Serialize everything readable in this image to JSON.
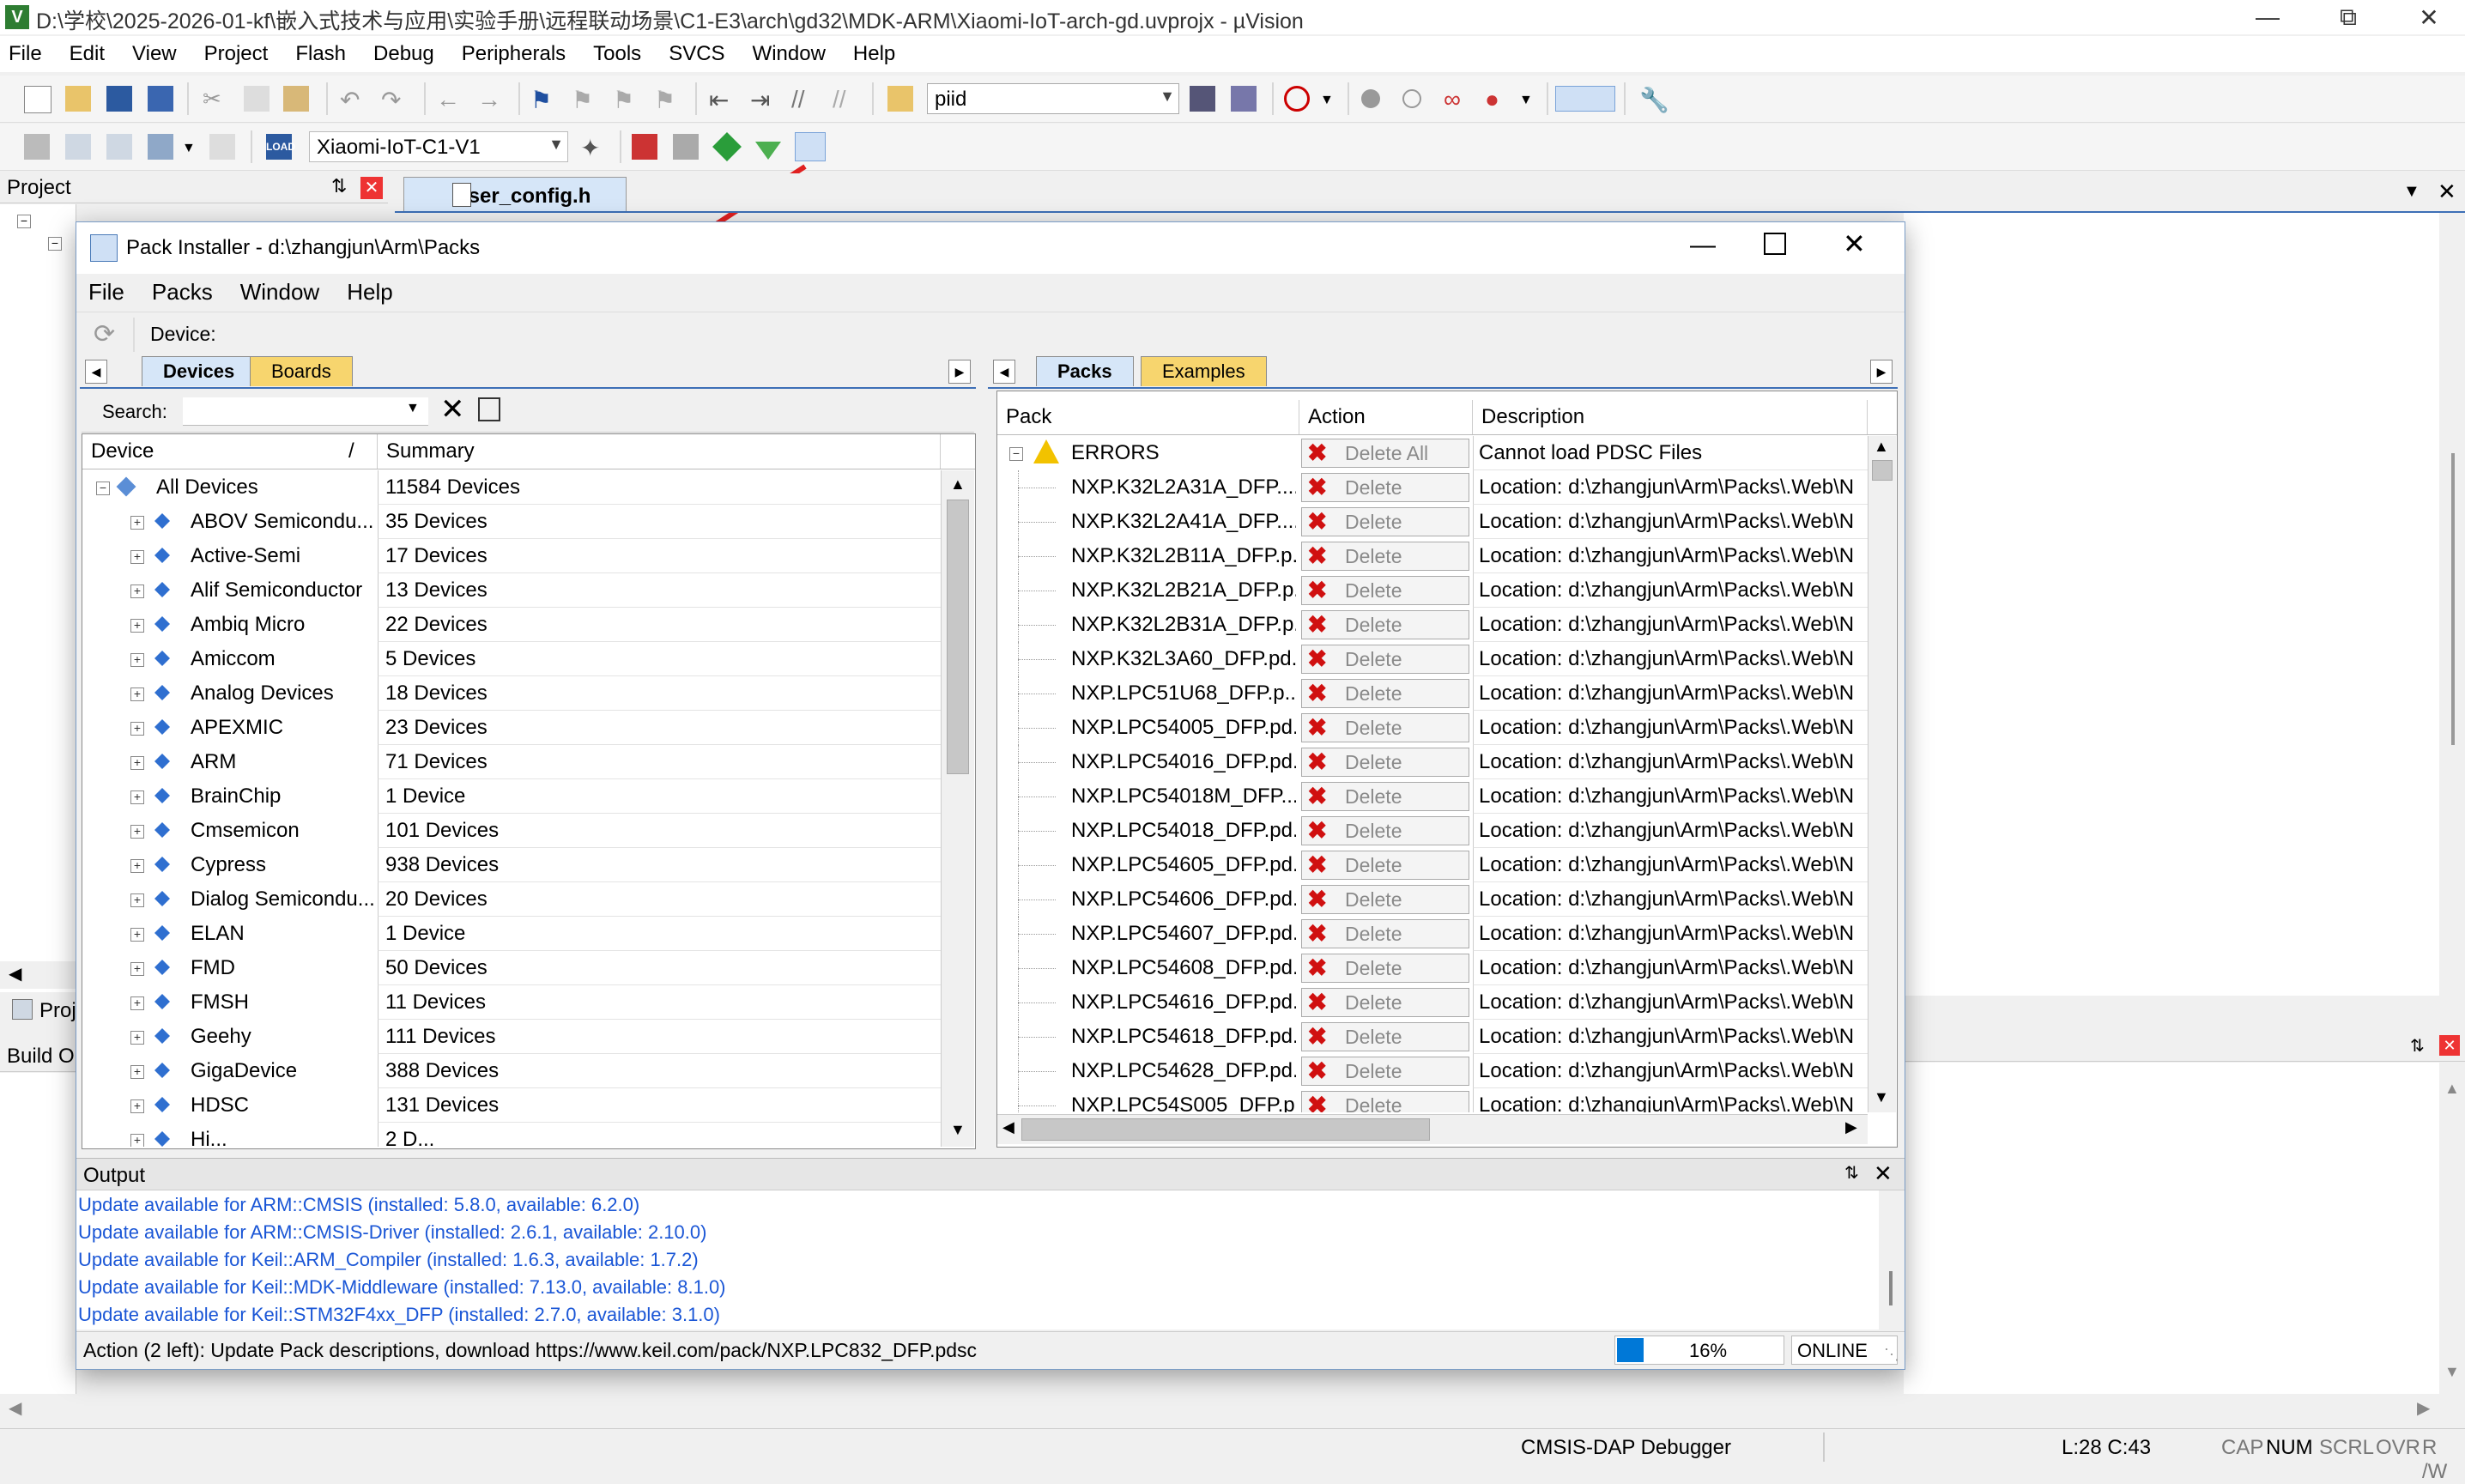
{
  "app": {
    "title": "D:\\学校\\2025-2026-01-kf\\嵌入式技术与应用\\实验手册\\远程联动场景\\C1-E3\\arch\\gd32\\MDK-ARM\\Xiaomi-IoT-arch-gd.uvprojx - µVision",
    "menu": [
      "File",
      "Edit",
      "View",
      "Project",
      "Flash",
      "Debug",
      "Peripherals",
      "Tools",
      "SVCS",
      "Window",
      "Help"
    ],
    "find_combo": "piid",
    "target_combo": "Xiaomi-IoT-C1-V1",
    "project_panel_title": "Project",
    "project_tab": "Proj",
    "build_output_title": "Build O",
    "editor_tab": "user_config.h",
    "status": {
      "debugger": "CMSIS-DAP Debugger",
      "position": "L:28 C:43",
      "cap": "CAP",
      "num": "NUM",
      "scrl": "SCRL",
      "ovr": "OVR",
      "rw": "R /W"
    }
  },
  "pack_installer": {
    "title": "Pack Installer - d:\\zhangjun\\Arm\\Packs",
    "menu": [
      "File",
      "Packs",
      "Window",
      "Help"
    ],
    "device_label": "Device:",
    "left_tabs": [
      "Devices",
      "Boards"
    ],
    "search_label": "Search:",
    "device_columns": [
      "Device",
      "Summary"
    ],
    "all_devices": {
      "name": "All Devices",
      "summary": "11584 Devices"
    },
    "vendors": [
      {
        "name": "ABOV Semicondu...",
        "summary": "35 Devices"
      },
      {
        "name": "Active-Semi",
        "summary": "17 Devices"
      },
      {
        "name": "Alif Semiconductor",
        "summary": "13 Devices"
      },
      {
        "name": "Ambiq Micro",
        "summary": "22 Devices"
      },
      {
        "name": "Amiccom",
        "summary": "5 Devices"
      },
      {
        "name": "Analog Devices",
        "summary": "18 Devices"
      },
      {
        "name": "APEXMIC",
        "summary": "23 Devices"
      },
      {
        "name": "ARM",
        "summary": "71 Devices"
      },
      {
        "name": "BrainChip",
        "summary": "1 Device"
      },
      {
        "name": "Cmsemicon",
        "summary": "101 Devices"
      },
      {
        "name": "Cypress",
        "summary": "938 Devices"
      },
      {
        "name": "Dialog Semicondu...",
        "summary": "20 Devices"
      },
      {
        "name": "ELAN",
        "summary": "1 Device"
      },
      {
        "name": "FMD",
        "summary": "50 Devices"
      },
      {
        "name": "FMSH",
        "summary": "11 Devices"
      },
      {
        "name": "Geehy",
        "summary": "111 Devices"
      },
      {
        "name": "GigaDevice",
        "summary": "388 Devices"
      },
      {
        "name": "HDSC",
        "summary": "131 Devices"
      },
      {
        "name": "Hi...",
        "summary": "2 D..."
      }
    ],
    "right_tabs": [
      "Packs",
      "Examples"
    ],
    "pack_columns": [
      "Pack",
      "Action",
      "Description"
    ],
    "errors_row": {
      "name": "ERRORS",
      "action": "Delete All",
      "description": "Cannot load PDSC Files"
    },
    "delete_label": "Delete",
    "location_text": "Location: d:\\zhangjun\\Arm\\Packs\\.Web\\N",
    "packs": [
      "NXP.K32L2A31A_DFP....",
      "NXP.K32L2A41A_DFP....",
      "NXP.K32L2B11A_DFP.p...",
      "NXP.K32L2B21A_DFP.p...",
      "NXP.K32L2B31A_DFP.p...",
      "NXP.K32L3A60_DFP.pd...",
      "NXP.LPC51U68_DFP.p...",
      "NXP.LPC54005_DFP.pd...",
      "NXP.LPC54016_DFP.pd...",
      "NXP.LPC54018M_DFP....",
      "NXP.LPC54018_DFP.pd...",
      "NXP.LPC54605_DFP.pd...",
      "NXP.LPC54606_DFP.pd...",
      "NXP.LPC54607_DFP.pd...",
      "NXP.LPC54608_DFP.pd...",
      "NXP.LPC54616_DFP.pd...",
      "NXP.LPC54618_DFP.pd...",
      "NXP.LPC54628_DFP.pd...",
      "NXP.LPC54S005_DFP.p..."
    ],
    "output_title": "Output",
    "output_lines": [
      "Update available for ARM::CMSIS (installed: 5.8.0,  available: 6.2.0)",
      "Update available for ARM::CMSIS-Driver (installed: 2.6.1,  available: 2.10.0)",
      "Update available for Keil::ARM_Compiler (installed: 1.6.3,  available: 1.7.2)",
      "Update available for Keil::MDK-Middleware (installed: 7.13.0,  available: 8.1.0)",
      "Update available for Keil::STM32F4xx_DFP (installed: 2.7.0,  available: 3.1.0)"
    ],
    "status_action": "Action (2 left): Update Pack descriptions, download https://www.keil.com/pack/NXP.LPC832_DFP.pdsc",
    "progress_percent": 16,
    "progress_label": "16%",
    "online": "ONLINE"
  },
  "colors": {
    "accent": "#0078d7",
    "tab_active": "#d6e6f8",
    "tab_inactive": "#f7d56e",
    "output_text": "#1a56d6",
    "arrow": "#e02020"
  }
}
